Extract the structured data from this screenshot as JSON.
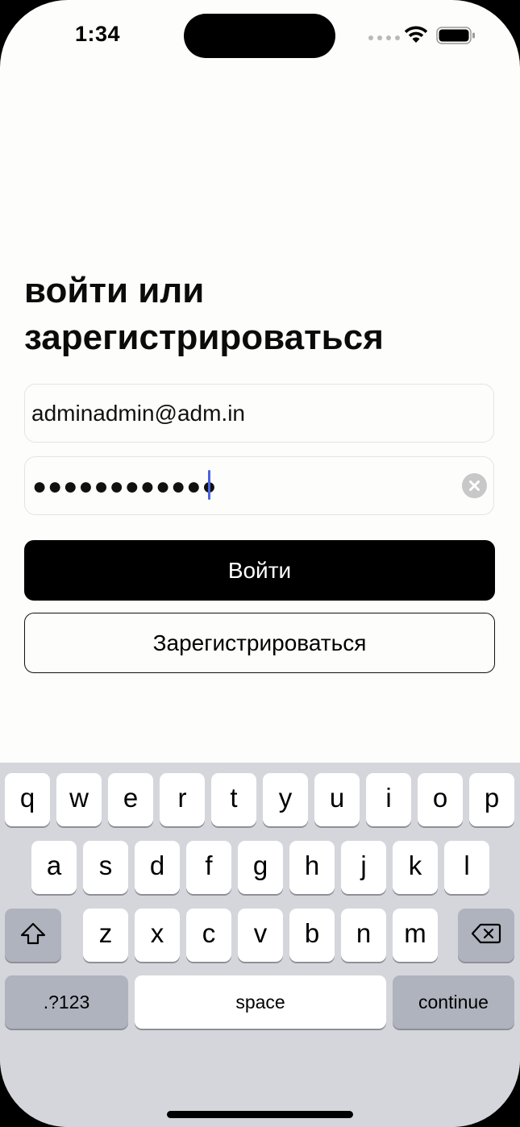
{
  "status_bar": {
    "time": "1:34"
  },
  "heading": "войти или зарегистрироваться",
  "email_field": {
    "value": "adminadmin@adm.in"
  },
  "password_field": {
    "masked_value": "●●●●●●●●●●●●",
    "length": 12
  },
  "buttons": {
    "login": "Войти",
    "register": "Зарегистрироваться"
  },
  "keyboard": {
    "row1": [
      "q",
      "w",
      "e",
      "r",
      "t",
      "y",
      "u",
      "i",
      "o",
      "p"
    ],
    "row2": [
      "a",
      "s",
      "d",
      "f",
      "g",
      "h",
      "j",
      "k",
      "l"
    ],
    "row3": [
      "z",
      "x",
      "c",
      "v",
      "b",
      "n",
      "m"
    ],
    "numbers": ".?123",
    "space": "space",
    "continue": "continue"
  },
  "colors": {
    "accent_caret": "#4b63e0",
    "primary_button": "#000000",
    "background": "#fdfdfb"
  }
}
